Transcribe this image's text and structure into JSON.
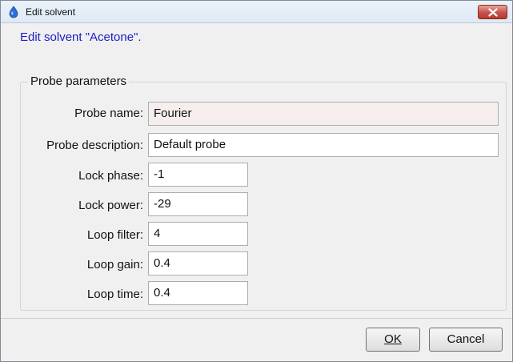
{
  "window": {
    "title": "Edit solvent"
  },
  "header": {
    "message": "Edit solvent \"Acetone\"."
  },
  "group": {
    "title": "Probe parameters"
  },
  "fields": {
    "probe_name": {
      "label": "Probe name:",
      "value": "Fourier"
    },
    "probe_description": {
      "label": "Probe description:",
      "value": "Default probe"
    },
    "lock_phase": {
      "label": "Lock phase:",
      "value": "-1"
    },
    "lock_power": {
      "label": "Lock power:",
      "value": "-29"
    },
    "loop_filter": {
      "label": "Loop filter:",
      "value": "4"
    },
    "loop_gain": {
      "label": "Loop gain:",
      "value": "0.4"
    },
    "loop_time": {
      "label": "Loop time:",
      "value": "0.4"
    }
  },
  "buttons": {
    "ok_label": "OK",
    "cancel_label": "Cancel"
  },
  "icons": {
    "app": "solvent-drop-icon",
    "close": "close-icon"
  },
  "colors": {
    "header_text": "#1d1dc8",
    "close_button": "#c75050"
  }
}
